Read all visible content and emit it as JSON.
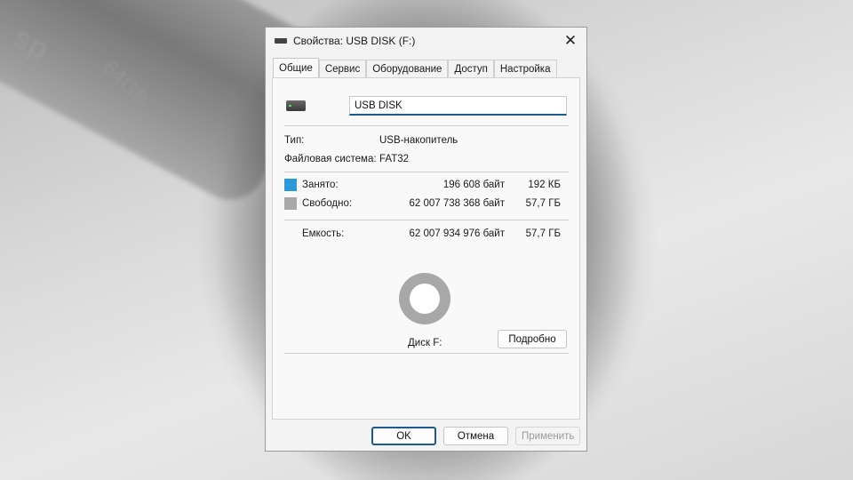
{
  "window": {
    "title": "Свойства: USB DISK (F:)",
    "close_glyph": "✕"
  },
  "tabs": [
    {
      "label": "Общие",
      "active": true
    },
    {
      "label": "Сервис",
      "active": false
    },
    {
      "label": "Оборудование",
      "active": false
    },
    {
      "label": "Доступ",
      "active": false
    },
    {
      "label": "Настройка",
      "active": false
    }
  ],
  "general": {
    "volume_name": "USB DISK",
    "type_label": "Тип:",
    "type_value": "USB-накопитель",
    "fs_label": "Файловая система:",
    "fs_value": "FAT32",
    "used_label": "Занято:",
    "used_bytes": "196 608 байт",
    "used_size": "192 КБ",
    "free_label": "Свободно:",
    "free_bytes": "62 007 738 368 байт",
    "free_size": "57,7 ГБ",
    "capacity_label": "Емкость:",
    "capacity_bytes": "62 007 934 976 байт",
    "capacity_size": "57,7 ГБ",
    "disk_label": "Диск F:",
    "details_button": "Подробно",
    "details_underline_char": "д"
  },
  "usage": {
    "used_fraction": 3.2e-06
  },
  "colors": {
    "used": "#2a9ad8",
    "free": "#a8a8a8",
    "accent": "#1c5a8a"
  },
  "buttons": {
    "ok": "OK",
    "cancel": "Отмена",
    "apply": "Применить"
  },
  "background": {
    "stick_brand": "sp",
    "stick_capacity": "64GB"
  },
  "icons": {
    "title_icon": "drive-icon",
    "volume_icon": "usb-drive-icon",
    "close_icon": "close-icon"
  }
}
